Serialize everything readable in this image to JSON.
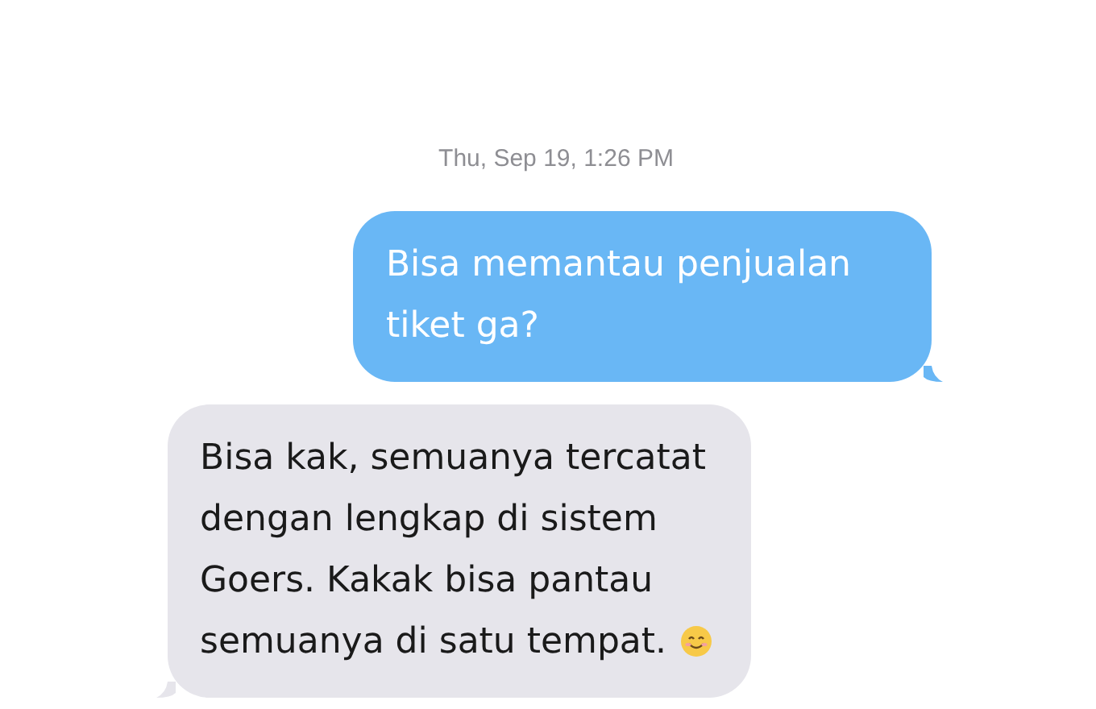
{
  "timestamp": "Thu, Sep 19, 1:26 PM",
  "messages": [
    {
      "kind": "sent",
      "lines": [
        "Bisa memantau penjualan",
        "tiket ga?"
      ],
      "emoji": false
    },
    {
      "kind": "received",
      "lines": [
        "Bisa kak, semuanya tercatat",
        "dengan lengkap di sistem",
        "Goers. Kakak bisa pantau",
        "semuanya di satu tempat."
      ],
      "emoji": true
    }
  ]
}
